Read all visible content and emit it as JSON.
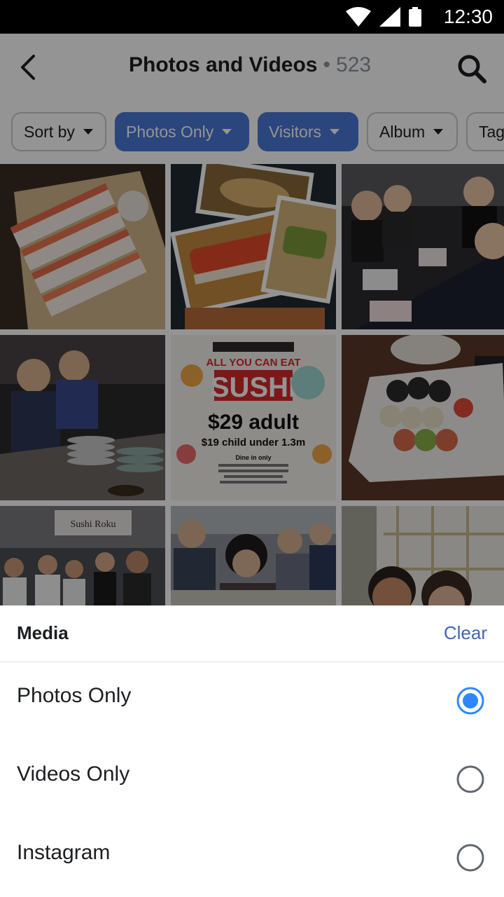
{
  "status_bar": {
    "time": "12:30"
  },
  "header": {
    "title": "Photos and Videos",
    "separator": "•",
    "count": "523"
  },
  "filters": [
    {
      "label": "Sort by",
      "active": false
    },
    {
      "label": "Photos Only",
      "active": true
    },
    {
      "label": "Visitors",
      "active": true
    },
    {
      "label": "Album",
      "active": false
    },
    {
      "label": "Tag",
      "active": false
    }
  ],
  "photos": {
    "poster": {
      "line1": "ALL YOU CAN EAT",
      "line2": "SUSHI",
      "line3": "$29 adult",
      "line4": "$19 child under 1.3m",
      "line5": "Dine in only"
    },
    "sign": "Sushi Roku"
  },
  "sheet": {
    "title": "Media",
    "clear_label": "Clear",
    "options": [
      {
        "label": "Photos Only",
        "selected": true
      },
      {
        "label": "Videos Only",
        "selected": false
      },
      {
        "label": "Instagram",
        "selected": false
      }
    ]
  },
  "colors": {
    "accent": "#4a78d8",
    "link": "#4267b2",
    "radio_selected": "#2d88ff",
    "radio_unselected": "#606770"
  }
}
